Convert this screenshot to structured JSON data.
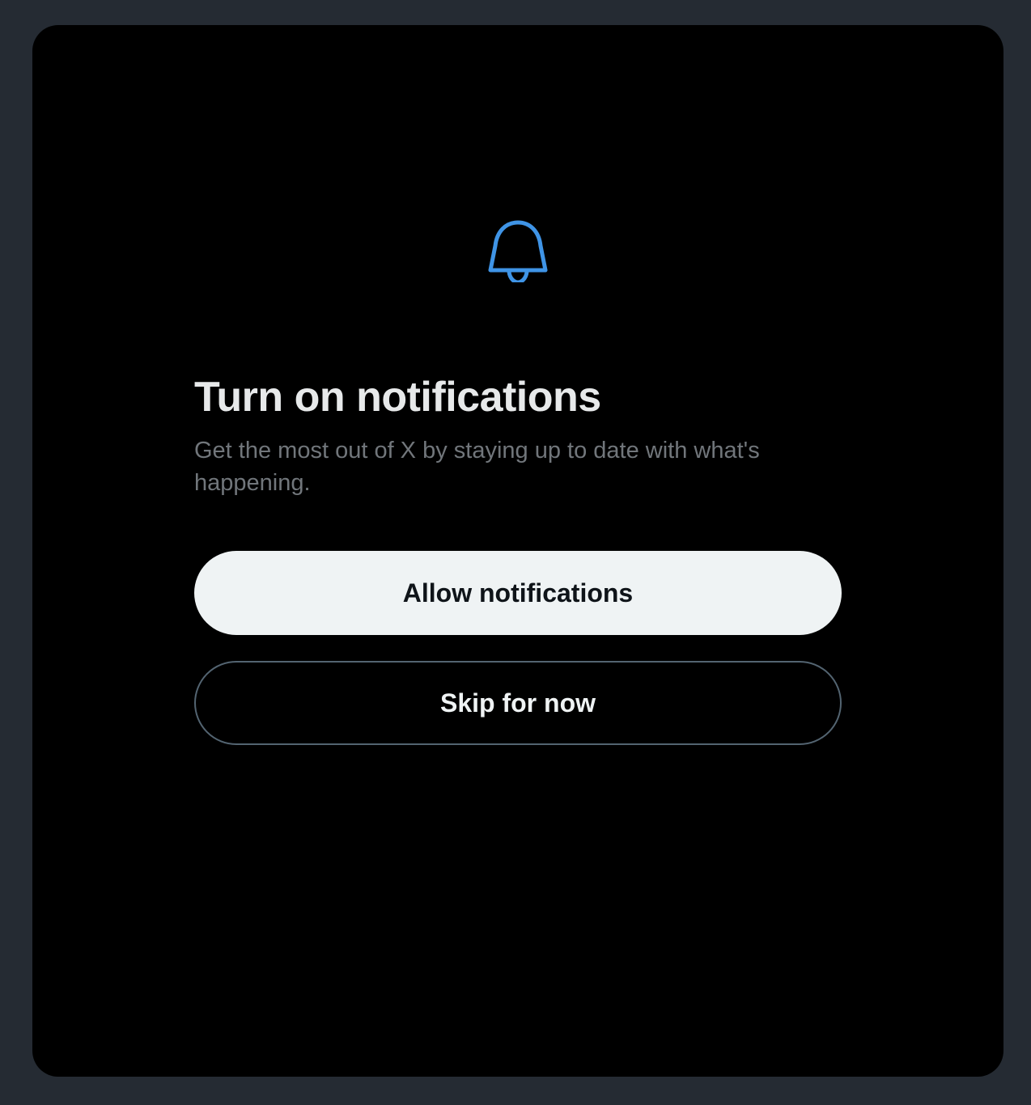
{
  "dialog": {
    "icon": "bell-icon",
    "title": "Turn on notifications",
    "subtitle": "Get the most out of X by staying up to date with what's happening.",
    "primary_button": "Allow notifications",
    "secondary_button": "Skip for now"
  },
  "colors": {
    "backdrop": "#252b33",
    "modal_background": "#000000",
    "accent": "#1d9bf0",
    "title_text": "#e7e9ea",
    "secondary_text": "#71767b",
    "primary_button_bg": "#eff3f4",
    "primary_button_text": "#0f1419",
    "secondary_button_border": "#536471"
  }
}
